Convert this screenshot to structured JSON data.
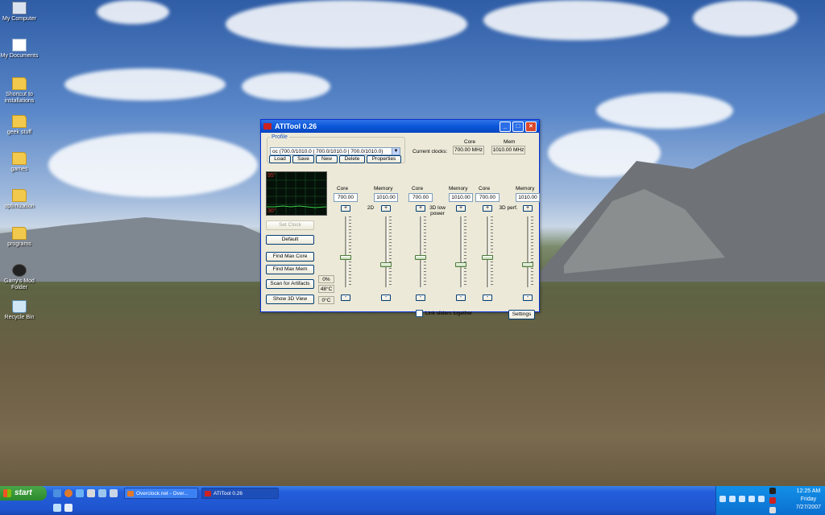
{
  "desktop": {
    "icons": [
      {
        "label": "My Computer",
        "icon": "computer-icon"
      },
      {
        "label": "My Documents",
        "icon": "documents-icon"
      },
      {
        "label": "Shortcut to installations",
        "icon": "folder-icon"
      },
      {
        "label": "geek stuff",
        "icon": "folder-icon"
      },
      {
        "label": "games",
        "icon": "folder-icon"
      },
      {
        "label": "optimization",
        "icon": "folder-icon"
      },
      {
        "label": "programs",
        "icon": "folder-icon"
      },
      {
        "label": "Garry's Mod Folder",
        "icon": "steam-icon"
      },
      {
        "label": "Recycle Bin",
        "icon": "recycle-bin-icon"
      }
    ]
  },
  "window": {
    "title": "ATITool 0.26",
    "profile": {
      "legend": "Profile",
      "selected": "oc (700.0/1010.0 | 700.0/1010.0 | 700.0/1010.0)",
      "buttons": [
        "Load",
        "Save",
        "New",
        "Delete",
        "Properties"
      ]
    },
    "current_clocks": {
      "label": "Current clocks:",
      "core_label": "Core",
      "mem_label": "Mem",
      "core_value": "700.00 MHz",
      "mem_value": "1010.00 MHz"
    },
    "graph": {
      "top_label": "95°",
      "bottom_label": "30°"
    },
    "side_buttons": {
      "set_clock": "Set Clock",
      "default": "Default",
      "find_max_core": "Find Max Core",
      "find_max_mem": "Find Max Mem",
      "scan_artifacts": "Scan for Artifacts",
      "show_3d_view": "Show 3D View"
    },
    "temps": {
      "percent": "0%",
      "temp": "48°C",
      "zero": "0°C"
    },
    "groups": [
      {
        "mode": "2D",
        "core_label": "Core",
        "memory_label": "Memory",
        "core_value": "700.00",
        "memory_value": "1010.00",
        "core_level": 0.42,
        "memory_level": 0.3
      },
      {
        "mode": "3D low power",
        "core_label": "Core",
        "memory_label": "Memory",
        "core_value": "700.00",
        "memory_value": "1010.00",
        "core_level": 0.42,
        "memory_level": 0.3
      },
      {
        "mode": "3D perf.",
        "core_label": "Core",
        "memory_label": "Memory",
        "core_value": "700.00",
        "memory_value": "1010.00",
        "core_level": 0.42,
        "memory_level": 0.3
      }
    ],
    "plus": "+",
    "minus": "-",
    "link_sliders": "Link sliders together",
    "settings": "Settings"
  },
  "taskbar": {
    "start": "start",
    "tasks": [
      {
        "label": "Overclock.net - Over...",
        "active": false
      },
      {
        "label": "ATITool 0.26",
        "active": true
      }
    ],
    "clock": {
      "time": "12:25 AM",
      "day": "Friday",
      "date": "7/27/2007"
    }
  }
}
